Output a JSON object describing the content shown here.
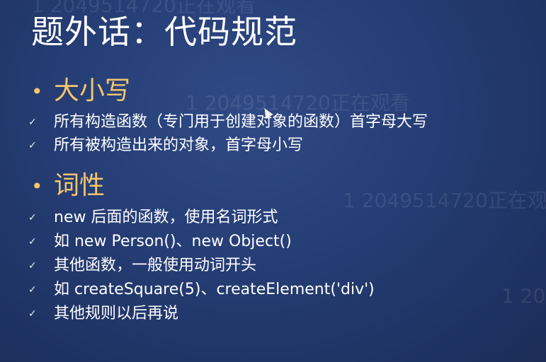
{
  "title": "题外话：代码规范",
  "sections": [
    {
      "label": "大小写",
      "items": [
        "所有构造函数（专门用于创建对象的函数）首字母大写",
        "所有被构造出来的对象，首字母小写"
      ]
    },
    {
      "label": "词性",
      "items": [
        "new 后面的函数，使用名词形式",
        "如 new Person()、new Object()",
        "其他函数，一般使用动词开头",
        "如 createSquare(5)、createElement('div')",
        "其他规则以后再说"
      ]
    }
  ],
  "watermarks": [
    "1 2049514720正在观看",
    "1 2049514720正在观看",
    "1 2049514720正在观",
    "1 20"
  ],
  "icons": {
    "section_bullet": "bullet-dot-icon",
    "item_check": "checkmark-icon",
    "pointer": "mouse-cursor-icon"
  },
  "colors": {
    "background": "#253d74",
    "accent": "#f3c66c",
    "text": "#ffffff"
  }
}
